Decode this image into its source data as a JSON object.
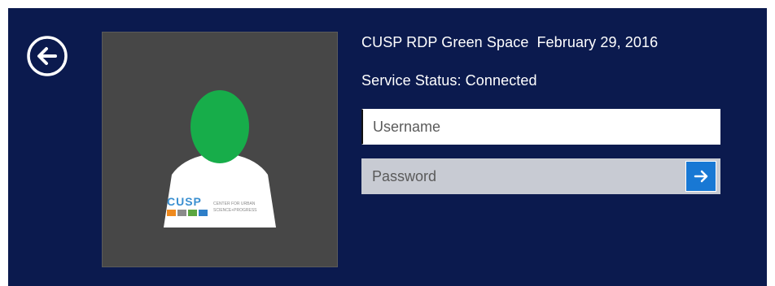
{
  "header": {
    "title": "CUSP RDP Green Space",
    "date": "February 29, 2016"
  },
  "status": {
    "text": "Service Status: Connected"
  },
  "form": {
    "username_placeholder": "Username",
    "password_placeholder": "Password"
  },
  "avatar": {
    "logo_text": "CUSP",
    "logo_subtext_line1": "CENTER FOR URBAN",
    "logo_subtext_line2": "SCIENCE+PROGRESS"
  },
  "icons": {
    "back": "back-arrow-circle-icon",
    "submit": "arrow-right-icon"
  },
  "colors": {
    "background": "#0b1a4e",
    "tile": "#474747",
    "head": "#17ad4a",
    "submit": "#1878d4"
  }
}
